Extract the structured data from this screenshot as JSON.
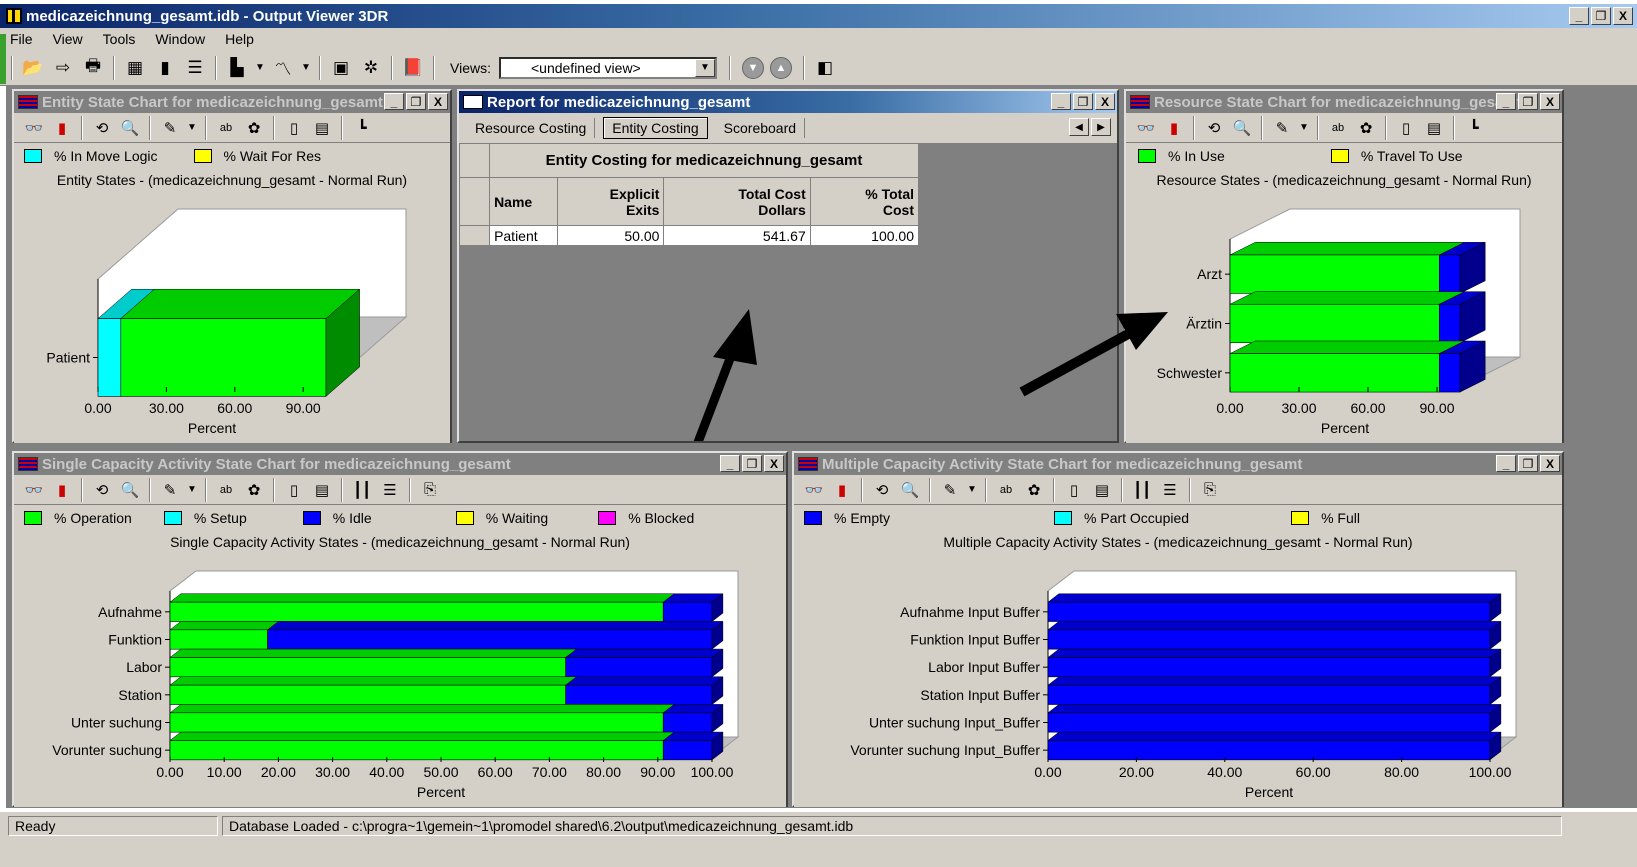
{
  "app": {
    "title": "medicazeichnung_gesamt.idb - Output Viewer 3DR",
    "window_buttons": [
      "_",
      "❐",
      "X"
    ]
  },
  "menu": [
    "File",
    "View",
    "Tools",
    "Window",
    "Help"
  ],
  "toolbar": {
    "views_label": "Views:",
    "views_value": "<undefined view>"
  },
  "windows": {
    "entity_chart": {
      "title": "Entity State Chart for medicazeichnung_gesamt",
      "legend": [
        {
          "label": "% In Move Logic",
          "color": "#00ffff"
        },
        {
          "label": "% Wait For Res",
          "color": "#ffff00"
        }
      ]
    },
    "report": {
      "title": "Report for medicazeichnung_gesamt",
      "tabs": [
        "Resource Costing",
        "Entity Costing",
        "Scoreboard"
      ],
      "selected_tab": "Entity Costing",
      "table_title": "Entity Costing for medicazeichnung_gesamt",
      "columns": [
        {
          "l1": "Name",
          "l2": ""
        },
        {
          "l1": "Explicit",
          "l2": "Exits"
        },
        {
          "l1": "Total Cost",
          "l2": "Dollars"
        },
        {
          "l1": "% Total",
          "l2": "Cost"
        }
      ],
      "rows": [
        [
          "Patient",
          "50.00",
          "541.67",
          "100.00"
        ]
      ]
    },
    "resource_chart": {
      "title": "Resource State Chart for medicazeichnung_gesamt",
      "legend": [
        {
          "label": "% In Use",
          "color": "#00ff00"
        },
        {
          "label": "% Travel To Use",
          "color": "#ffff00"
        }
      ]
    },
    "single_chart": {
      "title": "Single Capacity Activity State Chart for medicazeichnung_gesamt",
      "legend": [
        {
          "label": "% Operation",
          "color": "#00ff00"
        },
        {
          "label": "% Setup",
          "color": "#00ffff"
        },
        {
          "label": "% Idle",
          "color": "#0000ff"
        },
        {
          "label": "% Waiting",
          "color": "#ffff00"
        },
        {
          "label": "% Blocked",
          "color": "#ff00ff"
        }
      ]
    },
    "multi_chart": {
      "title": "Multiple Capacity Activity State Chart for medicazeichnung_gesamt",
      "legend": [
        {
          "label": "% Empty",
          "color": "#0000ff"
        },
        {
          "label": "% Part Occupied",
          "color": "#00ffff"
        },
        {
          "label": "% Full",
          "color": "#ffff00"
        }
      ]
    }
  },
  "chart_data": [
    {
      "type": "bar",
      "title": "Entity States - (medicazeichnung_gesamt - Normal Run)",
      "xlabel": "Percent",
      "categories": [
        "Patient"
      ],
      "xticks": [
        "0.00",
        "30.00",
        "60.00",
        "90.00"
      ],
      "xlim": [
        0,
        100
      ],
      "stacked": true,
      "series": [
        {
          "name": "% In Move Logic",
          "color": "#00ffff",
          "values": [
            10
          ]
        },
        {
          "name": "% Wait For Res",
          "color": "#00ff00",
          "values": [
            90
          ]
        }
      ]
    },
    {
      "type": "bar",
      "title": "Resource States - (medicazeichnung_gesamt - Normal Run)",
      "xlabel": "Percent",
      "categories": [
        "Arzt",
        "Ärztin",
        "Schwester"
      ],
      "xticks": [
        "0.00",
        "30.00",
        "60.00",
        "90.00"
      ],
      "xlim": [
        0,
        100
      ],
      "stacked": true,
      "series": [
        {
          "name": "% In Use",
          "color": "#00ff00",
          "values": [
            91,
            91,
            91
          ]
        },
        {
          "name": "",
          "color": "#0000ff",
          "values": [
            9,
            9,
            9
          ]
        }
      ]
    },
    {
      "type": "bar",
      "title": "Single Capacity Activity States - (medicazeichnung_gesamt - Normal Run)",
      "xlabel": "Percent",
      "categories": [
        "Aufnahme",
        "Funktion",
        "Labor",
        "Station",
        "Unter suchung",
        "Vorunter suchung"
      ],
      "xticks": [
        "0.00",
        "10.00",
        "20.00",
        "30.00",
        "40.00",
        "50.00",
        "60.00",
        "70.00",
        "80.00",
        "90.00",
        "100.00"
      ],
      "xlim": [
        0,
        100
      ],
      "stacked": true,
      "series": [
        {
          "name": "% Operation",
          "color": "#00ff00",
          "values": [
            91,
            18,
            73,
            73,
            91,
            91
          ]
        },
        {
          "name": "% Idle",
          "color": "#0000ff",
          "values": [
            9,
            82,
            27,
            27,
            9,
            9
          ]
        }
      ]
    },
    {
      "type": "bar",
      "title": "Multiple Capacity Activity States - (medicazeichnung_gesamt - Normal Run)",
      "xlabel": "Percent",
      "categories": [
        "Aufnahme Input Buffer",
        "Funktion Input Buffer",
        "Labor Input Buffer",
        "Station Input Buffer",
        "Unter suchung Input_Buffer",
        "Vorunter suchung Input_Buffer"
      ],
      "xticks": [
        "0.00",
        "20.00",
        "40.00",
        "60.00",
        "80.00",
        "100.00"
      ],
      "xlim": [
        0,
        100
      ],
      "stacked": true,
      "series": [
        {
          "name": "% Empty",
          "color": "#0000ff",
          "values": [
            100,
            100,
            100,
            100,
            100,
            100
          ]
        }
      ]
    }
  ],
  "status": {
    "left": "Ready",
    "right": "Database Loaded - c:\\progra~1\\gemein~1\\promodel shared\\6.2\\output\\medicazeichnung_gesamt.idb"
  }
}
